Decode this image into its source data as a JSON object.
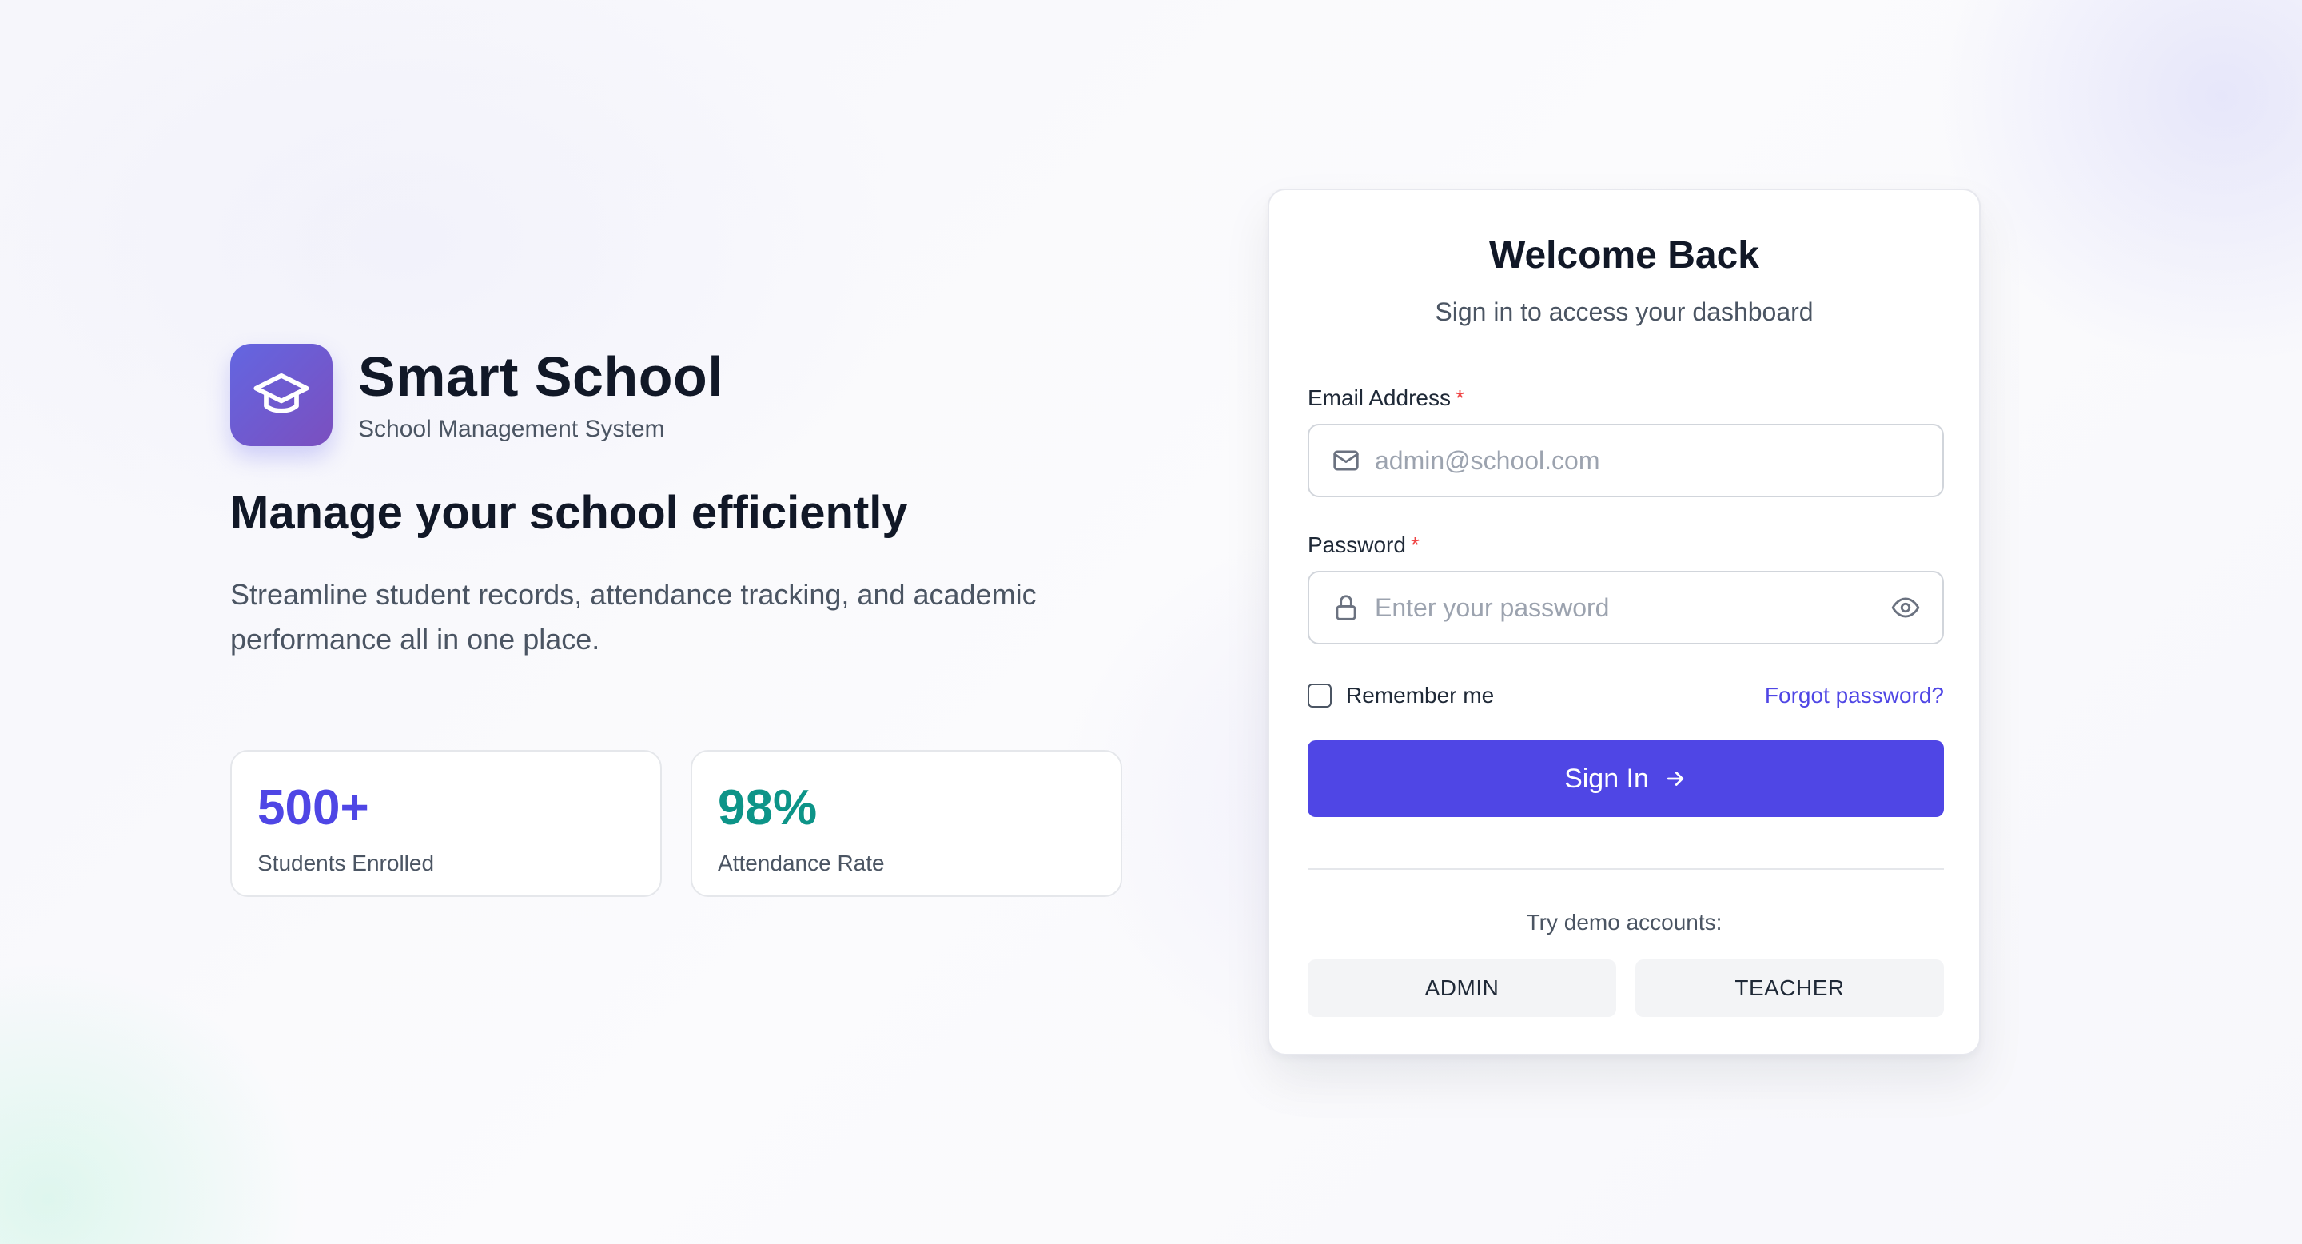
{
  "brand": {
    "title": "Smart School",
    "subtitle": "School Management System",
    "logo_icon": "graduation-cap-icon",
    "logo_gradient": [
      "#6366e1",
      "#7b4fbf"
    ]
  },
  "hero": {
    "headline": "Manage your school efficiently",
    "description": "Streamline student records, attendance tracking, and academic performance all in one place."
  },
  "stats": [
    {
      "value": "500+",
      "label": "Students Enrolled",
      "color": "#4f46e5"
    },
    {
      "value": "98%",
      "label": "Attendance Rate",
      "color": "#0d9488"
    }
  ],
  "login": {
    "title": "Welcome Back",
    "subtitle": "Sign in to access your dashboard",
    "email": {
      "label": "Email Address",
      "required_marker": "*",
      "placeholder": "admin@school.com",
      "value": "",
      "icon": "mail-icon"
    },
    "password": {
      "label": "Password",
      "required_marker": "*",
      "placeholder": "Enter your password",
      "value": "",
      "icon": "lock-icon",
      "toggle_icon": "eye-icon"
    },
    "remember_label": "Remember me",
    "remember_checked": false,
    "forgot_label": "Forgot password?",
    "submit_label": "Sign In",
    "submit_icon": "arrow-right-icon",
    "demo_label": "Try demo accounts:",
    "demo_accounts": [
      "ADMIN",
      "TEACHER"
    ]
  },
  "colors": {
    "primary": "#4f46e5",
    "accent_teal": "#0d9488",
    "required": "#ef4444",
    "text_dark": "#111827",
    "text_muted": "#4b5563"
  }
}
